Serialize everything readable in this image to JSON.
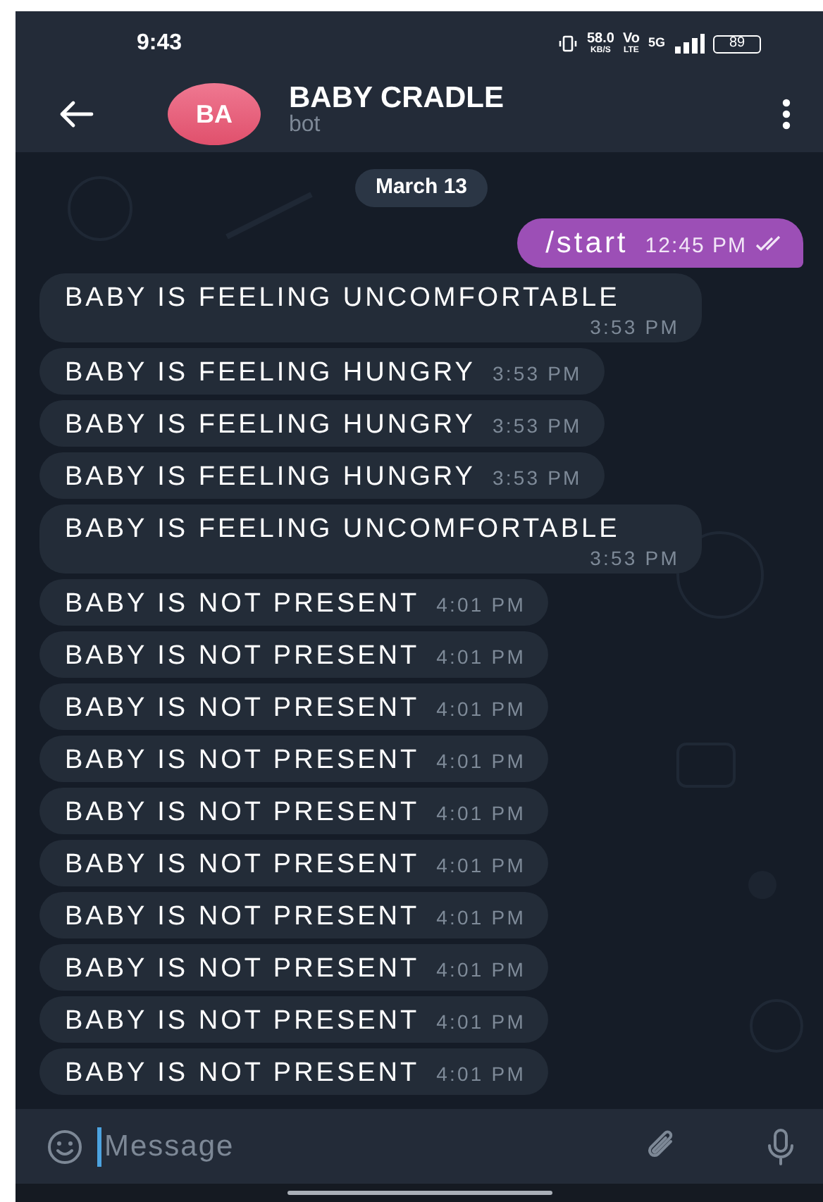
{
  "status_bar": {
    "time": "9:43",
    "speed": "58.0",
    "speed_unit": "KB/S",
    "volte_top": "Vo",
    "volte_bottom": "LTE",
    "network": "5G",
    "battery": "89"
  },
  "header": {
    "avatar": "BA",
    "title": "BABY CRADLE",
    "subtitle": "bot"
  },
  "date_chip": "March 13",
  "messages": [
    {
      "kind": "outgoing",
      "text": "/start",
      "time": "12:45 PM",
      "read": true
    },
    {
      "kind": "incoming",
      "text": "BABY IS FEELING UNCOMFORTABLE",
      "time": "3:53 PM"
    },
    {
      "kind": "incoming",
      "text": "BABY IS FEELING HUNGRY",
      "time": "3:53 PM"
    },
    {
      "kind": "incoming",
      "text": "BABY IS FEELING HUNGRY",
      "time": "3:53 PM"
    },
    {
      "kind": "incoming",
      "text": "BABY IS FEELING HUNGRY",
      "time": "3:53 PM"
    },
    {
      "kind": "incoming",
      "text": "BABY IS FEELING UNCOMFORTABLE",
      "time": "3:53 PM"
    },
    {
      "kind": "incoming",
      "text": "BABY IS NOT PRESENT",
      "time": "4:01 PM"
    },
    {
      "kind": "incoming",
      "text": "BABY IS NOT PRESENT",
      "time": "4:01 PM"
    },
    {
      "kind": "incoming",
      "text": "BABY IS NOT PRESENT",
      "time": "4:01 PM"
    },
    {
      "kind": "incoming",
      "text": "BABY IS NOT PRESENT",
      "time": "4:01 PM"
    },
    {
      "kind": "incoming",
      "text": "BABY IS NOT PRESENT",
      "time": "4:01 PM"
    },
    {
      "kind": "incoming",
      "text": "BABY IS NOT PRESENT",
      "time": "4:01 PM"
    },
    {
      "kind": "incoming",
      "text": "BABY IS NOT PRESENT",
      "time": "4:01 PM"
    },
    {
      "kind": "incoming",
      "text": "BABY IS NOT PRESENT",
      "time": "4:01 PM"
    },
    {
      "kind": "incoming",
      "text": "BABY IS NOT PRESENT",
      "time": "4:01 PM"
    },
    {
      "kind": "incoming",
      "text": "BABY IS NOT PRESENT",
      "time": "4:01 PM"
    }
  ],
  "composer": {
    "placeholder": "Message"
  }
}
